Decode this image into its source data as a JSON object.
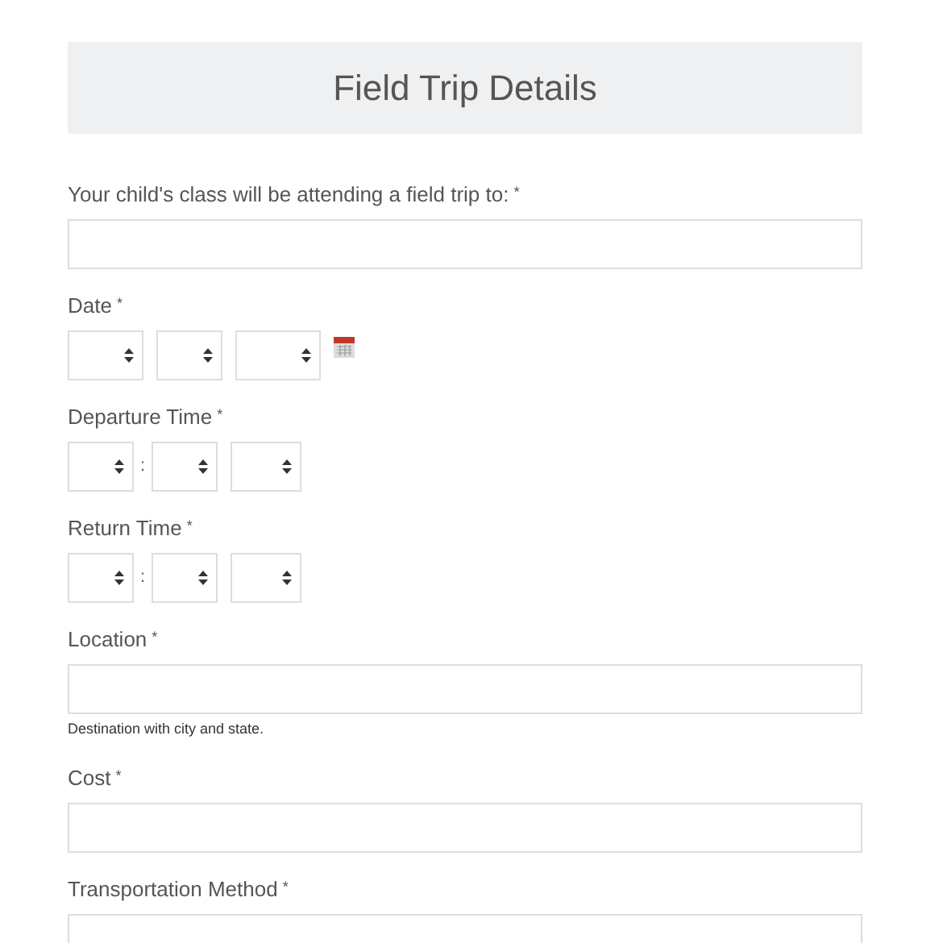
{
  "header": {
    "title": "Field Trip Details"
  },
  "required_mark": "*",
  "fields": [
    {
      "kind": "text",
      "label": "Your child's class will be attending a field trip to:",
      "required": true
    },
    {
      "kind": "date",
      "label": "Date",
      "required": true
    },
    {
      "kind": "time",
      "label": "Departure Time",
      "required": true,
      "separator": ":"
    },
    {
      "kind": "time",
      "label": "Return Time",
      "required": true,
      "separator": ":"
    },
    {
      "kind": "text",
      "label": "Location",
      "required": true,
      "help": "Destination with city and state."
    },
    {
      "kind": "text",
      "label": "Cost",
      "required": true
    },
    {
      "kind": "text",
      "label": "Transportation Method",
      "required": true
    }
  ]
}
